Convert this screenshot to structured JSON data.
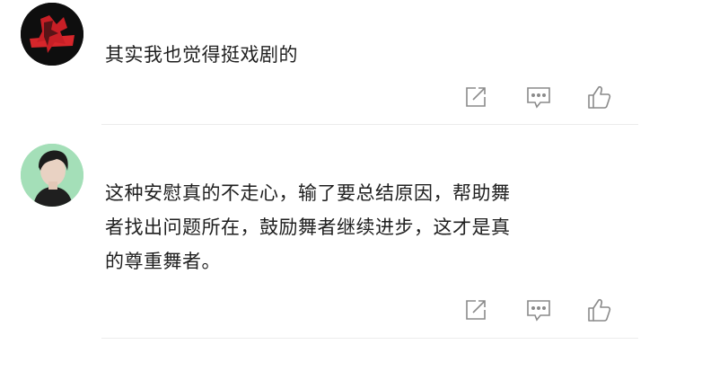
{
  "comments": [
    {
      "text": "其实我也觉得挺戏剧的"
    },
    {
      "lines": [
        "这种安慰真的不走心，输了要总结原因，帮助舞",
        "者找出问题所在，鼓励舞者继续进步，这才是真",
        "的尊重舞者。"
      ]
    }
  ],
  "icons": {
    "share": "share-icon",
    "reply": "comment-icon",
    "like": "thumbs-up-icon"
  }
}
